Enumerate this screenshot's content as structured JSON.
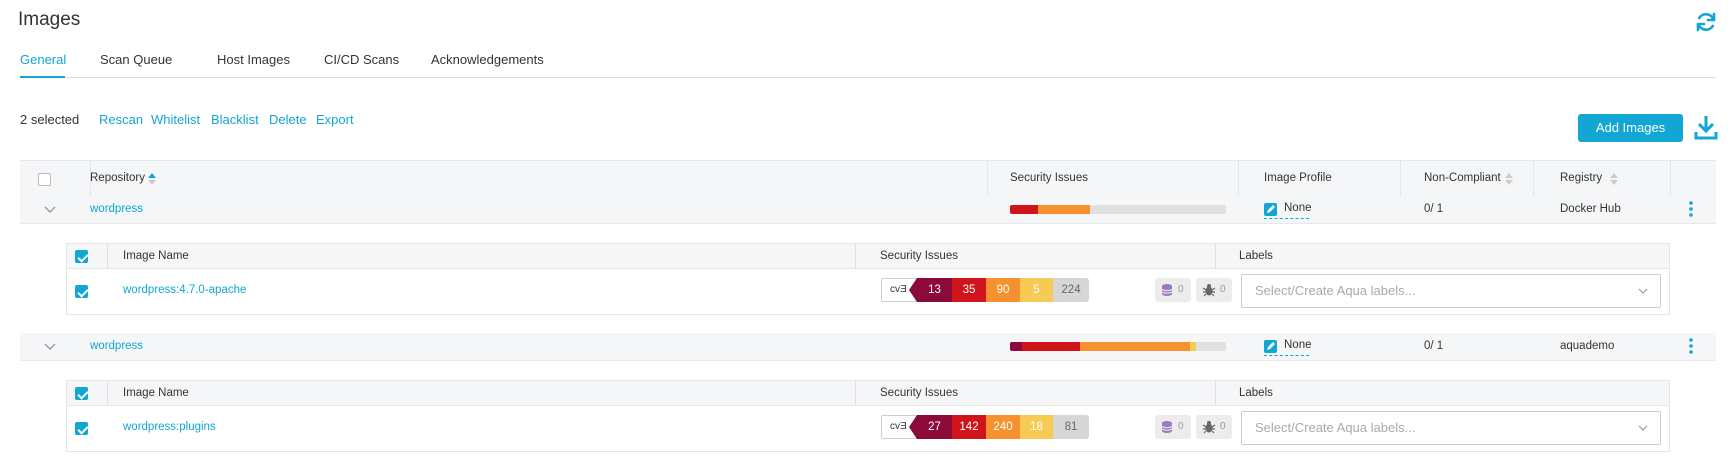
{
  "page": {
    "title": "Images"
  },
  "tabs": [
    "General",
    "Scan Queue",
    "Host Images",
    "CI/CD Scans",
    "Acknowledgements"
  ],
  "toolbar": {
    "selected": "2 selected",
    "actions": [
      "Rescan",
      "Whitelist",
      "Blacklist",
      "Delete",
      "Export"
    ],
    "add_button": "Add Images"
  },
  "table": {
    "headers": {
      "repository": "Repository",
      "security": "Security Issues",
      "profile": "Image Profile",
      "noncompliant": "Non-Compliant",
      "registry": "Registry"
    },
    "sub_headers": {
      "image_name": "Image Name",
      "security": "Security Issues",
      "labels": "Labels"
    },
    "groups": [
      {
        "repository": "wordpress",
        "profile": "None",
        "noncompliant": "0/ 1",
        "registry": "Docker Hub",
        "bar": [
          0.13,
          0.24,
          0.63
        ],
        "image": {
          "name": "wordpress:4.7.0-apache",
          "cve_label": "cvƎ",
          "critical": "13",
          "high": "35",
          "medium": "90",
          "low": "5",
          "negligible": "224",
          "malware": "0",
          "sensitive": "0",
          "labels_placeholder": "Select/Create Aqua labels..."
        }
      },
      {
        "repository": "wordpress",
        "profile": "None",
        "noncompliant": "0/ 1",
        "registry": "aquademo",
        "bar": [
          0.06,
          0.27,
          0.51,
          0.03,
          0.13
        ],
        "image": {
          "name": "wordpress:plugins",
          "cve_label": "cvƎ",
          "critical": "27",
          "high": "142",
          "medium": "240",
          "low": "18",
          "negligible": "81",
          "malware": "0",
          "sensitive": "0",
          "labels_placeholder": "Select/Create Aqua labels..."
        }
      }
    ]
  },
  "colors": {
    "accent": "#11a6d4",
    "critical": "#8b0a3a",
    "high": "#d0141c",
    "medium": "#f5922f",
    "low": "#f7c955",
    "negligible": "#d6d6d6"
  }
}
